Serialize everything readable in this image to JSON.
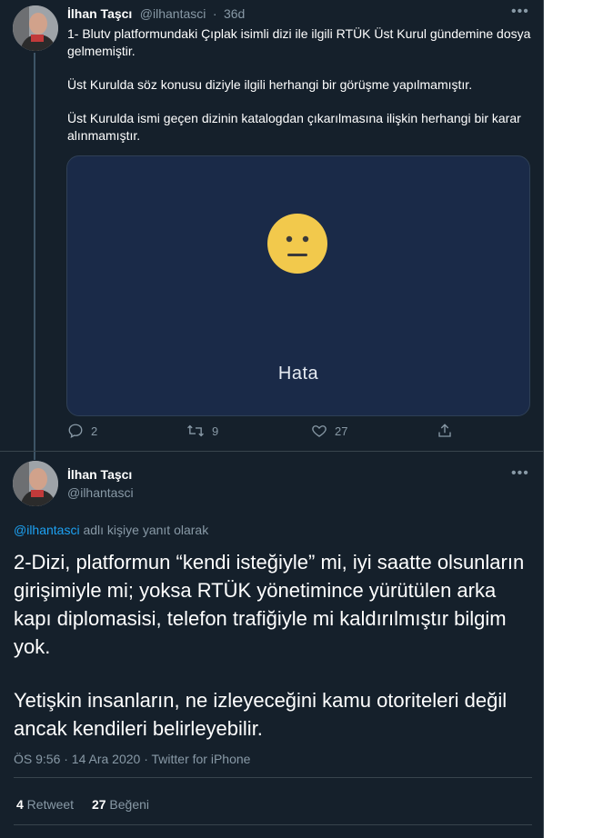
{
  "tweet1": {
    "author_name": "İlhan Taşcı",
    "handle": "@ilhantasci",
    "separator": "·",
    "time": "36d",
    "paragraphs": [
      "1- Blutv platformundaki Çıplak isimli dizi ile ilgili  RTÜK Üst Kurul gündemine dosya gelmemiştir.",
      "Üst Kurulda söz konusu diziyle ilgili herhangi bir görüşme yapılmamıştır.",
      "Üst Kurulda ismi geçen dizinin katalogdan çıkarılmasına ilişkin herhangi bir karar alınmamıştır."
    ],
    "media_error_text": "Hata",
    "actions": {
      "replies": "2",
      "retweets": "9",
      "likes": "27"
    }
  },
  "tweet2": {
    "author_name": "İlhan Taşcı",
    "handle": "@ilhantasci",
    "reply_handle": "@ilhantasci",
    "reply_suffix": " adlı kişiye yanıt olarak",
    "paragraphs": [
      "2-Dizi, platformun “kendi isteğiyle” mi, iyi saatte olsunların girişimiyle mi; yoksa RTÜK yönetimince yürütülen arka kapı diplomasisi, telefon trafiğiyle mi kaldırılmıştır bilgim yok.",
      "Yetişkin insanların, ne izleyeceğini kamu otoriteleri değil ancak kendileri belirleyebilir."
    ],
    "timestamp": "ÖS 9:56 · 14 Ara 2020 · Twitter for iPhone",
    "retweet_count": "4",
    "retweet_label": " Retweet",
    "like_count": "27",
    "like_label": " Beğeni"
  },
  "colors": {
    "background": "#15202b",
    "text": "#ffffff",
    "muted": "#8899a6",
    "link": "#1da1f2",
    "media_bg": "#1a2a48",
    "emoji": "#f2c94c"
  }
}
